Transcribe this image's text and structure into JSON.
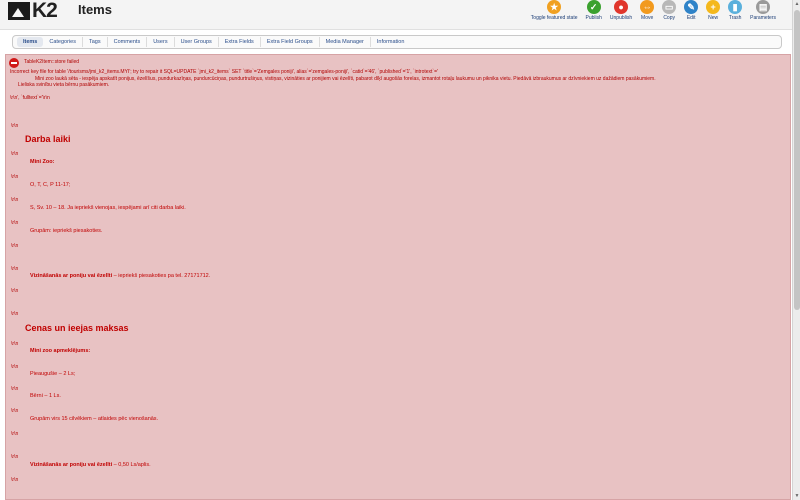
{
  "header": {
    "logo_text": "K2",
    "page_title": "Items"
  },
  "toolbar": [
    {
      "label": "Toggle featured state",
      "icon": "star-icon",
      "glyph": "★",
      "color": "#f0a020"
    },
    {
      "label": "Publish",
      "icon": "publish-check-icon",
      "glyph": "✓",
      "color": "#3ba12f"
    },
    {
      "label": "Unpublish",
      "icon": "unpublish-icon",
      "glyph": "●",
      "color": "#e0362c"
    },
    {
      "label": "Move",
      "icon": "move-arrows-icon",
      "glyph": "⇔",
      "color": "#f29a1e"
    },
    {
      "label": "Copy",
      "icon": "copy-icon",
      "glyph": "▭",
      "color": "#b8b8b8"
    },
    {
      "label": "Edit",
      "icon": "edit-pencil-icon",
      "glyph": "✎",
      "color": "#2f83c8"
    },
    {
      "label": "New",
      "icon": "new-plus-icon",
      "glyph": "+",
      "color": "#f4b81c"
    },
    {
      "label": "Trash",
      "icon": "trash-icon",
      "glyph": "▮",
      "color": "#5ab0dc"
    },
    {
      "label": "Parameters",
      "icon": "parameters-icon",
      "glyph": "▤",
      "color": "#9a9a9a"
    }
  ],
  "tabs": [
    {
      "label": "Items",
      "active": true
    },
    {
      "label": "Categories"
    },
    {
      "label": "Tags"
    },
    {
      "label": "Comments"
    },
    {
      "label": "Users"
    },
    {
      "label": "User Groups"
    },
    {
      "label": "Extra Fields"
    },
    {
      "label": "Extra Field Groups"
    },
    {
      "label": "Media Manager"
    },
    {
      "label": "Information"
    }
  ],
  "error": {
    "head": "TableK2Item::store failed",
    "line1": "Incorrect key file for table '/tourisms/jmi_k2_items.MYI'; try to repair it SQL=UPDATE `jmi_k2_items` SET `title`='Zemgales poniji', alias`='zemgales-poniji', `catid`='46', `published`='1', `introtext`='",
    "line2": "Mini zoo laukā sēta - iespēja apskatīt ponijus, ēzelīšus, pundurkazīņas, pundurcūciņas, pundurtrušiņus, vistiņas, vizināties ar ponijiem vai ēzelīti, pabarot dīķī augošās forelas, izmantot rotaļu laukumu un piknika vietu. Piedāvā izbraukumus ar dzīvniekiem uz dažādiem pasākumiem.",
    "line3": "Lieliska svinību vieta bērnu pasākumiem.",
    "line4": "\\r\\n', `fulltext`='\\r\\n",
    "rn": "\\r\\n"
  },
  "content": {
    "h_darba": "Darba laiki",
    "mini_zoo": "Mini Zoo:",
    "days": "O, T, C, P 11-17;",
    "weekend": "S, Sv. 10 – 18. Ja iepriekš vienojas, iespējami arī citi darba laiki.",
    "groups1": "Grupām: iepriekš piesakoties.",
    "riding1_bold": "Vizināšanās ar poniju vai ēzelīti",
    "riding1_rest": " – iepriekš piesakoties pa tel. 27171712.",
    "h_cenas": "Cenas un ieejas maksas",
    "mini_zoo_price": "Mini zoo apmeklējums:",
    "adults": "Pieaugušie – 2 Ls;",
    "kids": "Bērni – 1 Ls.",
    "groups2": "Grupām virs 15 cilvēkiem – atlaides pēc vienošanās.",
    "riding2_bold": "Vizināšanās ar poniju vai ēzelīti",
    "riding2_rest": " – 0,50 Ls/aplis."
  }
}
